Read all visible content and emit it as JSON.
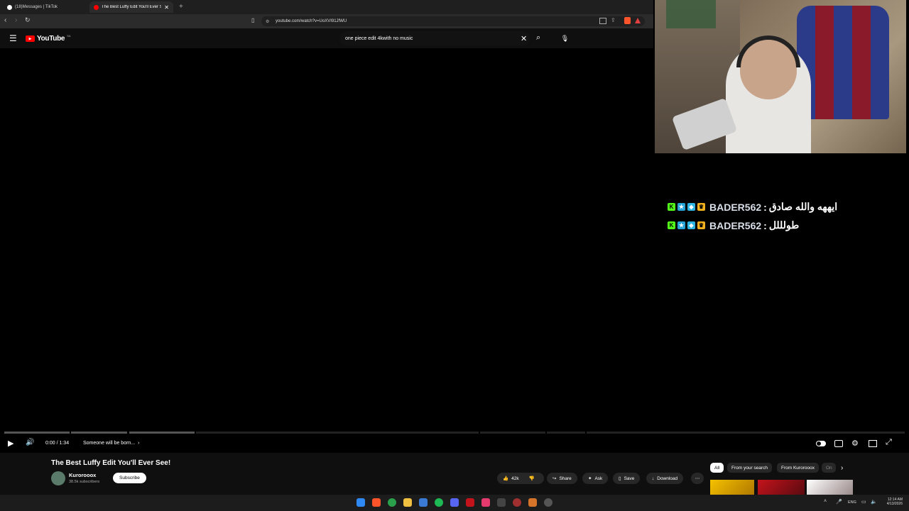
{
  "browser": {
    "tabs": [
      {
        "label": "(18)Messages | TikTok",
        "active": false
      },
      {
        "label": "The Best Luffy Edit You'll Ever Se",
        "active": true
      }
    ],
    "new_tab_icon": "plus-icon",
    "url": "youtube.com/watch?v=UoXVI91JfWU"
  },
  "youtube": {
    "logo_text": "YouTube",
    "country_code": "SA",
    "search_value": "one piece edit 4kwith no music"
  },
  "player": {
    "time": "0:00 / 1:34",
    "chapter": "Someone will be born...",
    "progress": 0,
    "colors": {
      "accent": "#ff0000",
      "bg": "#0f0f0f"
    }
  },
  "chat": [
    {
      "user": "BADER562",
      "message": "ايههه والله صادق"
    },
    {
      "user": "BADER562",
      "message": "طولللل"
    }
  ],
  "video_info": {
    "title": "The Best Luffy Edit You'll Ever See!",
    "channel": "Kurorooox",
    "subscribers": "38.5k subscribers",
    "subscribe_label": "Subscribe",
    "likes": "42k",
    "share_label": "Share",
    "ask_label": "Ask",
    "save_label": "Save",
    "download_label": "Download"
  },
  "filters": {
    "chips": [
      "All",
      "From your search",
      "From Kurorooox",
      "On"
    ]
  },
  "taskbar": {
    "language": "ENG",
    "time": "12:14 AM",
    "date": "4/13/2026"
  }
}
